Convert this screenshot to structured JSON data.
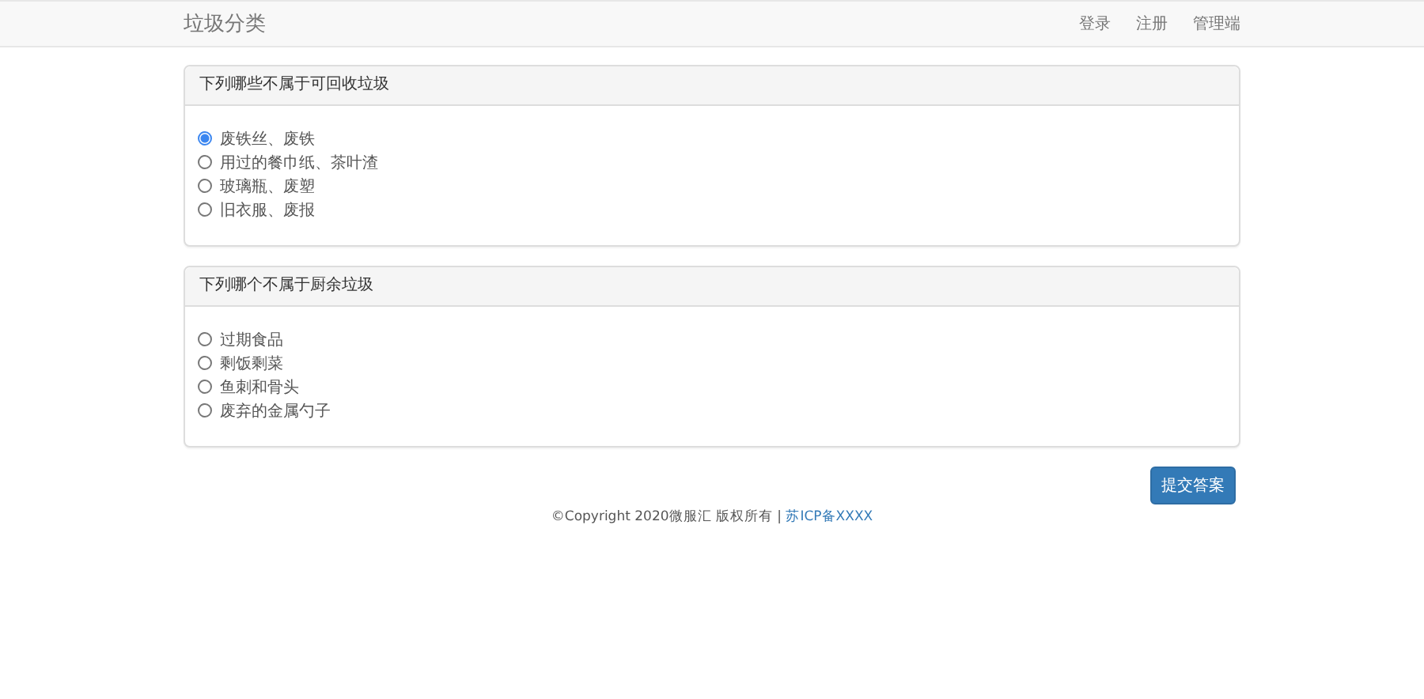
{
  "navbar": {
    "brand": "垃圾分类",
    "links": [
      {
        "label": "登录"
      },
      {
        "label": "注册"
      },
      {
        "label": "管理端"
      }
    ]
  },
  "questions": [
    {
      "title": "下列哪些不属于可回收垃圾",
      "options": [
        {
          "label": "废铁丝、废铁",
          "selected": true
        },
        {
          "label": "用过的餐巾纸、茶叶渣",
          "selected": false
        },
        {
          "label": "玻璃瓶、废塑",
          "selected": false
        },
        {
          "label": "旧衣服、废报",
          "selected": false
        }
      ]
    },
    {
      "title": "下列哪个不属于厨余垃圾",
      "options": [
        {
          "label": "过期食品",
          "selected": false
        },
        {
          "label": "剩饭剩菜",
          "selected": false
        },
        {
          "label": "鱼刺和骨头",
          "selected": false
        },
        {
          "label": "废弃的金属勺子",
          "selected": false
        }
      ]
    }
  ],
  "submit_button": "提交答案",
  "footer": {
    "text": "©Copyright 2020微服汇 版权所有 | ",
    "link": "苏ICP备XXXX"
  }
}
